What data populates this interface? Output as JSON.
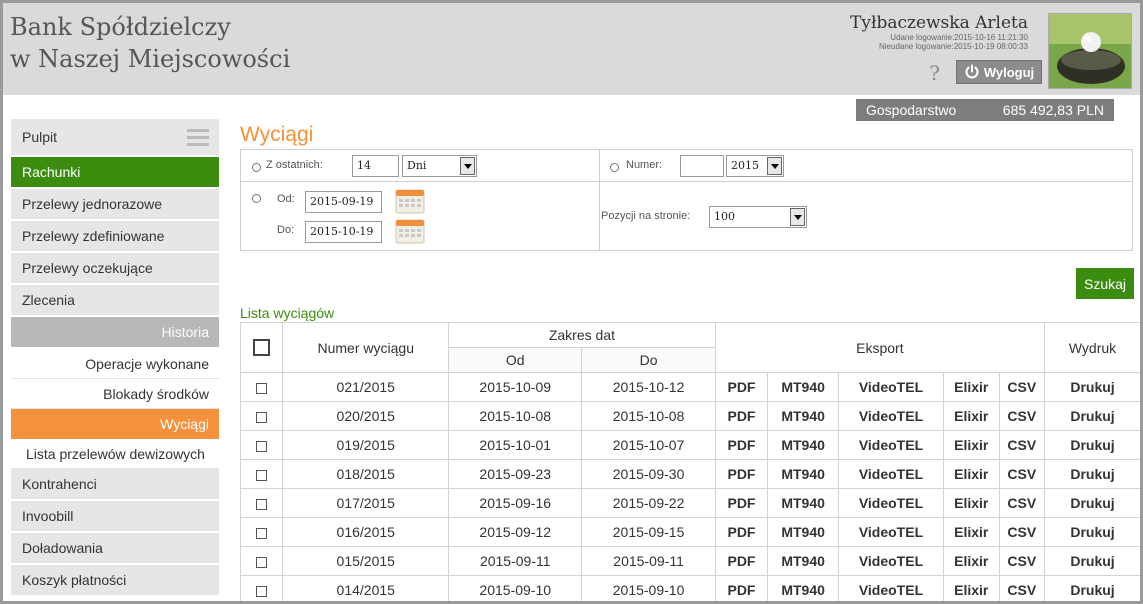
{
  "header": {
    "bank_line1": "Bank Spółdzielczy",
    "bank_line2": "w Naszej Miejscowości",
    "user_name": "Tyłbaczewska Arleta",
    "last_login_ok": "Udane logowanie:2015-10-16 11:21:30",
    "last_login_fail": "Nieudane logowanie:2015-10-19 08:00:33",
    "help_label": "?",
    "logout_label": "Wyloguj"
  },
  "account": {
    "name": "Gospodarstwo",
    "balance": "685 492,83 PLN"
  },
  "sidebar": {
    "items": [
      {
        "label": "Pulpit"
      },
      {
        "label": "Rachunki"
      },
      {
        "label": "Przelewy jednorazowe"
      },
      {
        "label": "Przelewy zdefiniowane"
      },
      {
        "label": "Przelewy oczekujące"
      },
      {
        "label": "Zlecenia"
      },
      {
        "label": "Historia"
      },
      {
        "label": "Operacje wykonane"
      },
      {
        "label": "Blokady środków"
      },
      {
        "label": "Wyciągi"
      },
      {
        "label": "Lista przelewów dewizowych"
      },
      {
        "label": "Kontrahenci"
      },
      {
        "label": "Invoobill"
      },
      {
        "label": "Doładowania"
      },
      {
        "label": "Koszyk płatności"
      }
    ]
  },
  "page": {
    "title": "Wyciągi"
  },
  "filters": {
    "last_label": "Z ostatnich:",
    "last_value": "14",
    "last_unit": "Dni",
    "number_label": "Numer:",
    "number_value": "",
    "number_year": "2015",
    "from_label": "Od:",
    "from_value": "2015-09-19",
    "to_label": "Do:",
    "to_value": "2015-10-19",
    "per_page_label": "Pozycji na stronie:",
    "per_page_value": "100",
    "search_label": "Szukaj"
  },
  "list": {
    "title": "Lista wyciągów",
    "col_number": "Numer wyciągu",
    "col_range": "Zakres dat",
    "col_from": "Od",
    "col_to": "Do",
    "col_export": "Eksport",
    "col_print": "Wydruk",
    "export_labels": [
      "PDF",
      "MT940",
      "VideoTEL",
      "Elixir",
      "CSV"
    ],
    "print_label": "Drukuj",
    "rows": [
      {
        "number": "021/2015",
        "from": "2015-10-09",
        "to": "2015-10-12"
      },
      {
        "number": "020/2015",
        "from": "2015-10-08",
        "to": "2015-10-08"
      },
      {
        "number": "019/2015",
        "from": "2015-10-01",
        "to": "2015-10-07"
      },
      {
        "number": "018/2015",
        "from": "2015-09-23",
        "to": "2015-09-30"
      },
      {
        "number": "017/2015",
        "from": "2015-09-16",
        "to": "2015-09-22"
      },
      {
        "number": "016/2015",
        "from": "2015-09-12",
        "to": "2015-09-15"
      },
      {
        "number": "015/2015",
        "from": "2015-09-11",
        "to": "2015-09-11"
      },
      {
        "number": "014/2015",
        "from": "2015-09-10",
        "to": "2015-09-10"
      }
    ]
  },
  "colors": {
    "accent_green": "#3c8c10",
    "accent_orange": "#f7913d"
  }
}
